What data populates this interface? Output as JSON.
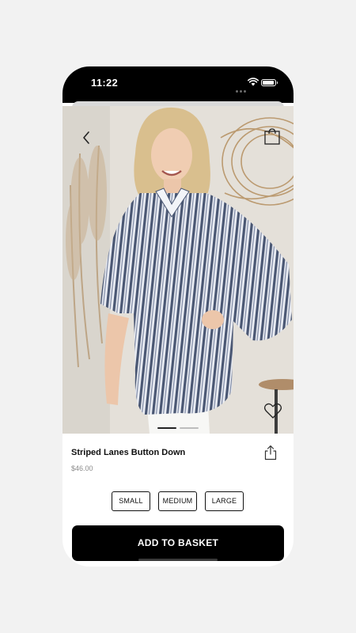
{
  "status_bar": {
    "time": "11:22"
  },
  "product": {
    "title": "Striped Lanes Button Down",
    "price": "$46.00",
    "image_description_icon": "product-photo"
  },
  "sizes": [
    "SMALL",
    "MEDIUM",
    "LARGE"
  ],
  "actions": {
    "add_to_basket": "ADD TO BASKET"
  },
  "icons": {
    "back": "chevron-left-icon",
    "bag": "shopping-bag-icon",
    "favorite": "heart-icon",
    "share": "share-icon"
  },
  "colors": {
    "background": "#f2f2f2",
    "status_bar": "#000000",
    "primary_button": "#000000",
    "price_text": "#8a8a8a"
  }
}
